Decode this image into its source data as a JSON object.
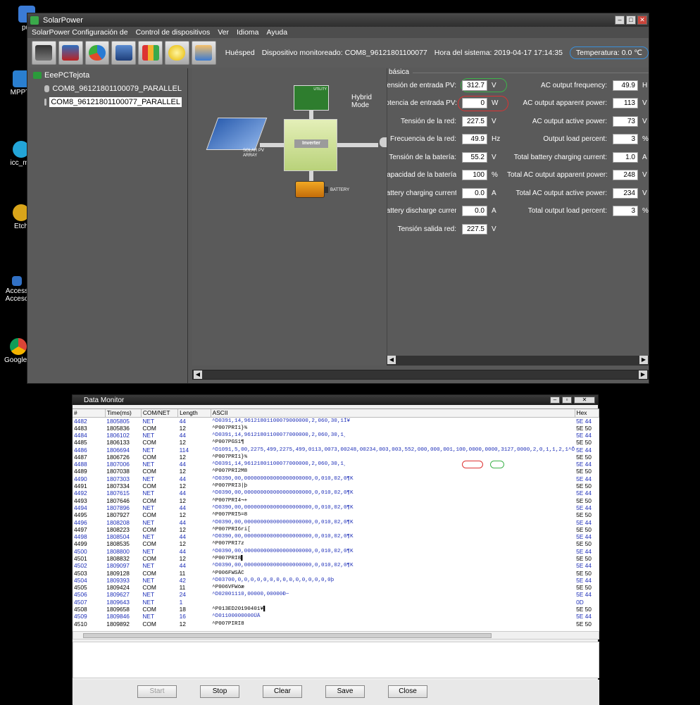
{
  "desktop": {
    "icons": [
      {
        "label": "put"
      },
      {
        "label": "MPPTr"
      },
      {
        "label": "icc_mc"
      },
      {
        "label": "Etch"
      },
      {
        "label": "Access Acceso"
      },
      {
        "label": "Google C"
      }
    ]
  },
  "solarpower": {
    "title": "SolarPower",
    "menu": [
      "SolarPower Configuración de",
      "Control de dispositivos",
      "Ver",
      "Idioma",
      "Ayuda"
    ],
    "toolbar_icons": [
      "monitor-icon",
      "tools-icon",
      "report-icon",
      "camera-icon",
      "data-icon",
      "bulb-icon",
      "users-icon"
    ],
    "status": {
      "user": "Huésped",
      "device_label": "Dispositivo monitoreado:",
      "device": "COM8_96121801100077",
      "time_label": "Hora del sistema:",
      "time": "2019-04-17 17:14:35",
      "temp_label": "Temperatura:",
      "temp": "0.0 ℃"
    },
    "tree": {
      "root": "EeePCTejota",
      "nodes": [
        "COM8_96121801100079_PARALLEL",
        "COM8_96121801100077_PARALLEL"
      ]
    },
    "diagram": {
      "utility": "UTILITY",
      "hybrid": "Hybrid Mode",
      "pv": "SOLAR PV ARRAY",
      "inverter": "Inverter",
      "battery": "BATTERY"
    },
    "panel_title": "básica",
    "left_params": [
      {
        "label": "Tensión de entrada PV:",
        "value": "312.7",
        "unit": "V"
      },
      {
        "label": "potencia de entrada PV:",
        "value": "0",
        "unit": "W"
      },
      {
        "label": "Tensión de la red:",
        "value": "227.5",
        "unit": "V"
      },
      {
        "label": "Frecuencia de la red:",
        "value": "49.9",
        "unit": "Hz"
      },
      {
        "label": "Tensión de la batería:",
        "value": "55.2",
        "unit": "V"
      },
      {
        "label": "Capacidad de la batería:",
        "value": "100",
        "unit": "%"
      },
      {
        "label": "Battery charging current:",
        "value": "0.0",
        "unit": "A"
      },
      {
        "label": "Battery discharge current:",
        "value": "0.0",
        "unit": "A"
      },
      {
        "label": "Tensión salida red:",
        "value": "227.5",
        "unit": "V"
      }
    ],
    "right_params": [
      {
        "label": "AC output frequency:",
        "value": "49.9",
        "unit": "H"
      },
      {
        "label": "AC output apparent power:",
        "value": "113",
        "unit": "V"
      },
      {
        "label": "AC output active power:",
        "value": "73",
        "unit": "V"
      },
      {
        "label": "Output load percent:",
        "value": "3",
        "unit": "%"
      },
      {
        "label": "Total battery charging current:",
        "value": "1.0",
        "unit": "A"
      },
      {
        "label": "Total AC output apparent power:",
        "value": "248",
        "unit": "V"
      },
      {
        "label": "Total AC output active power:",
        "value": "234",
        "unit": "V"
      },
      {
        "label": "Total output load percent:",
        "value": "3",
        "unit": "%"
      }
    ]
  },
  "monitor": {
    "title": "Data Monitor",
    "columns": [
      "#",
      "Time(ms)",
      "COM/NET",
      "Length",
      "ASCII",
      "Hex"
    ],
    "rows": [
      [
        "4482",
        "1805805",
        "NET",
        "44",
        "^D0391,14,96121801100079000000,2,060,30,1Ì¥",
        "5E 44"
      ],
      [
        "4483",
        "1805836",
        "COM",
        "12",
        "^P007PRI1}¾",
        "5E 50"
      ],
      [
        "4484",
        "1806102",
        "NET",
        "44",
        "^D0391,14,96121801100077000000,2,060,30,1¸",
        "5E 44"
      ],
      [
        "4485",
        "1806133",
        "COM",
        "12",
        "^P007PGS1¶",
        "5E 50"
      ],
      [
        "4486",
        "1806694",
        "NET",
        "114",
        "^D1091,5,00,2275,499,2275,499,0113,0073,00248,00234,003,003,552,000,000,001,100,0000,0000,3127,0000,2,0,1,1,2,1^Ô",
        "5E 44"
      ],
      [
        "4487",
        "1806726",
        "COM",
        "12",
        "^P007PRI1}¾",
        "5E 50"
      ],
      [
        "4488",
        "1807006",
        "NET",
        "44",
        "^D0391,14,96121801100077000000,2,060,30,1¸",
        "5E 44"
      ],
      [
        "4489",
        "1807038",
        "COM",
        "12",
        "^P007PRI2M8",
        "5E 50"
      ],
      [
        "4490",
        "1807303",
        "NET",
        "44",
        "^D0390,00,000000000000000000000,0,010,02,0¶K",
        "5E 44"
      ],
      [
        "4491",
        "1807334",
        "COM",
        "12",
        "^P007PRI3|þ",
        "5E 50"
      ],
      [
        "4492",
        "1807615",
        "NET",
        "44",
        "^D0390,00,000000000000000000000,0,010,02,0¶K",
        "5E 44"
      ],
      [
        "4493",
        "1807646",
        "COM",
        "12",
        "^P007PRI4¬+",
        "5E 50"
      ],
      [
        "4494",
        "1807896",
        "NET",
        "44",
        "^D0390,00,000000000000000000000,0,010,02,0¶K",
        "5E 44"
      ],
      [
        "4495",
        "1807927",
        "COM",
        "12",
        "^P007PRI5=8",
        "5E 50"
      ],
      [
        "4496",
        "1808208",
        "NET",
        "44",
        "^D0390,00,000000000000000000000,0,010,02,0¶K",
        "5E 44"
      ],
      [
        "4497",
        "1808223",
        "COM",
        "12",
        "^P007PRI6ri[",
        "5E 50"
      ],
      [
        "4498",
        "1808504",
        "NET",
        "44",
        "^D0390,00,000000000000000000000,0,010,02,0¶K",
        "5E 44"
      ],
      [
        "4499",
        "1808535",
        "COM",
        "12",
        "^P007PRI7z",
        "5E 50"
      ],
      [
        "4500",
        "1808800",
        "NET",
        "44",
        "^D0390,00,000000000000000000000,0,010,02,0¶K",
        "5E 44"
      ],
      [
        "4501",
        "1808832",
        "COM",
        "12",
        "^P007PRI8▌",
        "5E 50"
      ],
      [
        "4502",
        "1809097",
        "NET",
        "44",
        "^D0390,00,000000000000000000000,0,010,02,0¶K",
        "5E 44"
      ],
      [
        "4503",
        "1809128",
        "COM",
        "11",
        "^P006FWSÄC",
        "5E 50"
      ],
      [
        "4504",
        "1809393",
        "NET",
        "42",
        "^D03700,0,0,0,0,0,0,0,0,0,0,0,0,0,0,0þ",
        "5E 44"
      ],
      [
        "4505",
        "1809424",
        "COM",
        "11",
        "^P006VFWöæ",
        "5E 50"
      ],
      [
        "4506",
        "1809627",
        "NET",
        "24",
        "^D02001110,00000,00000Ð~",
        "5E 44"
      ],
      [
        "4507",
        "1809643",
        "NET",
        "1",
        "",
        "0D"
      ],
      [
        "4508",
        "1809658",
        "COM",
        "18",
        "^P013ED20190401¥▌",
        "5E 50"
      ],
      [
        "4509",
        "1809846",
        "NET",
        "16",
        "^D01100000000ÜÄ",
        "5E 44"
      ],
      [
        "4510",
        "1809892",
        "COM",
        "12",
        "^P007PIRI8",
        "5E 50"
      ]
    ],
    "buttons": {
      "start": "Start",
      "stop": "Stop",
      "clear": "Clear",
      "save": "Save",
      "close": "Close"
    }
  }
}
